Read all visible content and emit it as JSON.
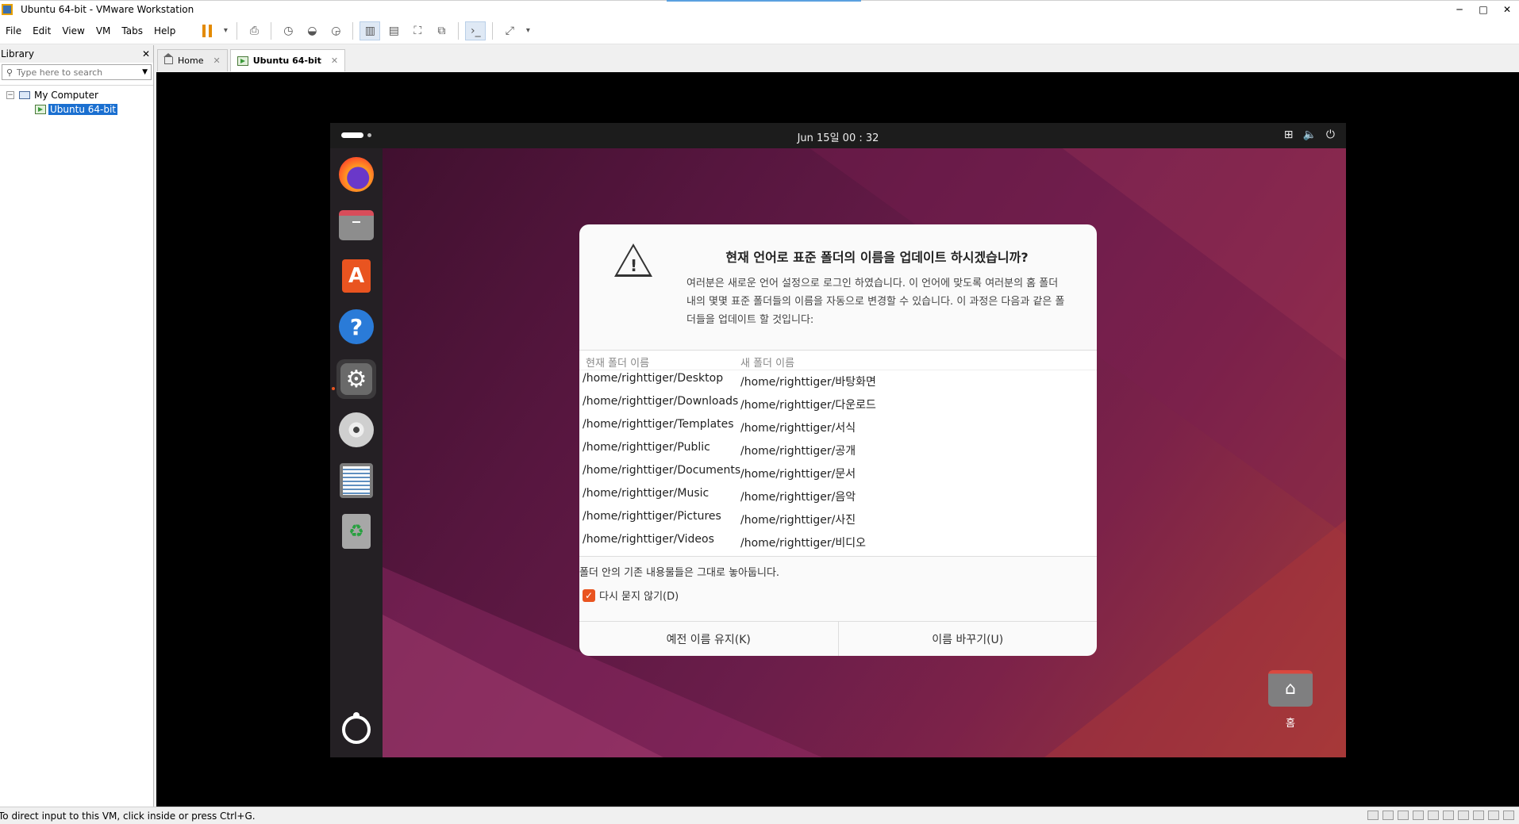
{
  "window": {
    "title": "Ubuntu 64-bit - VMware Workstation",
    "minimize": "─",
    "maximize": "□",
    "close": "✕"
  },
  "menu": [
    "File",
    "Edit",
    "View",
    "VM",
    "Tabs",
    "Help"
  ],
  "toolbar": {
    "pause_dropdown": "▾",
    "view_dropdown": "▾"
  },
  "library": {
    "title": "Library",
    "close": "✕",
    "search_placeholder": "Type here to search",
    "tree_root": "My Computer",
    "tree_child": "Ubuntu 64-bit",
    "toggle": "−"
  },
  "tabs": [
    {
      "label": "Home",
      "close": "✕"
    },
    {
      "label": "Ubuntu 64-bit",
      "close": "✕"
    }
  ],
  "status": {
    "text": "To direct input to this VM, click inside or press Ctrl+G."
  },
  "guest": {
    "clock": "Jun 15일  00 : 32",
    "tray": {
      "network": "⊞",
      "volume": "🔈",
      "power": "⏻"
    },
    "desktop_home_label": "홈",
    "dialog": {
      "title": "현재 언어로 표준 폴더의 이름을 업데이트 하시겠습니까?",
      "body": "여러분은 새로운 언어 설정으로 로그인 하였습니다. 이 언어에 맞도록 여러분의 홈 폴더 내의 몇몇 표준 폴더들의 이름을 자동으로 변경할 수 있습니다. 이 과정은 다음과 같은 폴더들을 업데이트 할 것입니다:",
      "col_current": "현재 폴더 이름",
      "col_new": "새 폴더 이름",
      "rows": [
        {
          "current": "/home/righttiger/Desktop",
          "new": "/home/righttiger/바탕화면"
        },
        {
          "current": "/home/righttiger/Downloads",
          "new": "/home/righttiger/다운로드"
        },
        {
          "current": "/home/righttiger/Templates",
          "new": "/home/righttiger/서식"
        },
        {
          "current": "/home/righttiger/Public",
          "new": "/home/righttiger/공개"
        },
        {
          "current": "/home/righttiger/Documents",
          "new": "/home/righttiger/문서"
        },
        {
          "current": "/home/righttiger/Music",
          "new": "/home/righttiger/음악"
        },
        {
          "current": "/home/righttiger/Pictures",
          "new": "/home/righttiger/사진"
        },
        {
          "current": "/home/righttiger/Videos",
          "new": "/home/righttiger/비디오"
        }
      ],
      "note": "폴더 안의 기존 내용물들은 그대로 놓아둡니다.",
      "checkbox_label": "다시 묻지 않기(D)",
      "checkbox_checked": true,
      "keep_button": "예전 이름 유지(K)",
      "rename_button": "이름 바꾸기(U)"
    },
    "accent_color": "#e95420"
  }
}
